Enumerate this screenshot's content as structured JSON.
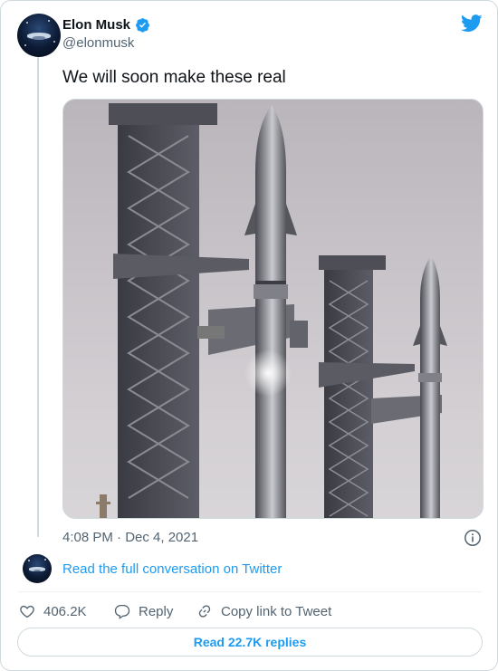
{
  "author": {
    "name": "Elon Musk",
    "handle": "@elonmusk",
    "verified": true
  },
  "brand": {
    "logo_icon": "twitter-bird-icon",
    "accent": "#1d9bf0"
  },
  "tweet": {
    "text": "We will soon make these real",
    "timestamp": "4:08 PM · Dec 4, 2021",
    "media_alt": "Two Starship rockets on launch towers"
  },
  "thread": {
    "read_full": "Read the full conversation on Twitter"
  },
  "actions": {
    "like_count": "406.2K",
    "reply_label": "Reply",
    "copy_label": "Copy link to Tweet"
  },
  "replies_button": "Read 22.7K replies"
}
